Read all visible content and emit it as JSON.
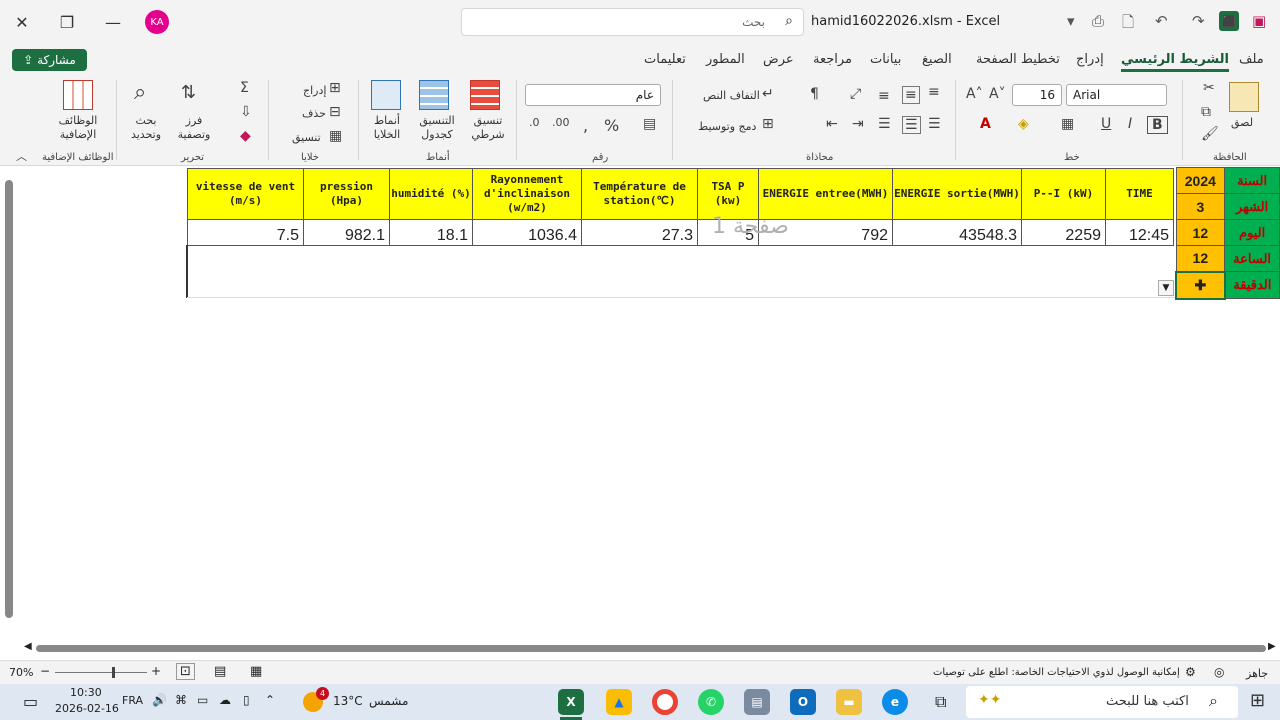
{
  "title_bar": {
    "avatar_initials": "KA",
    "search_placeholder": "بحث",
    "document_title": "hamid16022026.xlsm  -  Excel"
  },
  "menu_tabs": [
    {
      "label": "ملف"
    },
    {
      "label": "الشريط الرئيسي",
      "active": true
    },
    {
      "label": "إدراج"
    },
    {
      "label": "تخطيط الصفحة"
    },
    {
      "label": "الصيغ"
    },
    {
      "label": "بيانات"
    },
    {
      "label": "مراجعة"
    },
    {
      "label": "عرض"
    },
    {
      "label": "المطور"
    },
    {
      "label": "تعليمات"
    }
  ],
  "share_button": "مشاركة",
  "ribbon": {
    "clipboard": {
      "group": "الحافظة",
      "paste": "لصق"
    },
    "font": {
      "group": "خط",
      "name": "Arial",
      "size": "16",
      "bold": "B",
      "italic": "I",
      "underline": "U"
    },
    "alignment": {
      "group": "محاذاة",
      "wrap": "التفاف النص",
      "merge": "دمج وتوسيط"
    },
    "number": {
      "group": "رقم",
      "format": "عام"
    },
    "styles": {
      "group": "أنماط",
      "conditional": "تنسيق شرطي",
      "as_table": "التنسيق كجدول",
      "cell_styles": "أنماط الخلايا"
    },
    "cells": {
      "group": "خلايا",
      "insert": "إدراج",
      "delete": "حذف",
      "format": "تنسيق"
    },
    "editing": {
      "group": "تحرير",
      "sort": "فرز وتصفية",
      "find": "بحث وتحديد"
    },
    "addins": {
      "group": "الوظائف الإضافية",
      "label": "الوظائف الإضافية"
    }
  },
  "sheet": {
    "headers": [
      "vitesse de vent (m/s)",
      "pression (Hpa)",
      "humidité (%)",
      "Rayonnement d'inclinaison (w/m2)",
      "Température de station(℃)",
      "TSA P (kw)",
      "ENERGIE entree(MWH)",
      "ENERGIE sortie(MWH)",
      "P--I (kW)",
      "TIME"
    ],
    "values": [
      "7.5",
      "982.1",
      "18.1",
      "1036.4",
      "27.3",
      "5",
      "792",
      "43548.3",
      "2259",
      "12:45"
    ],
    "side_values": [
      "2024",
      "3",
      "12",
      "12",
      ""
    ],
    "side_labels": [
      "السنة",
      "الشهر",
      "اليوم",
      "الساعة",
      "الدقيقة"
    ],
    "watermark": "صفحة 1"
  },
  "status_bar": {
    "zoom": "70%",
    "accessibility": "إمكانية الوصول لذوي الاحتياجات الخاصة: اطلع على توصيات",
    "ready": "جاهز"
  },
  "taskbar": {
    "time": "10:30",
    "date": "2026-02-16",
    "lang": "FRA",
    "weather": "13°C",
    "weather_desc": "مشمس",
    "weather_badge": "4",
    "search_placeholder": "اكتب هنا للبحث"
  }
}
